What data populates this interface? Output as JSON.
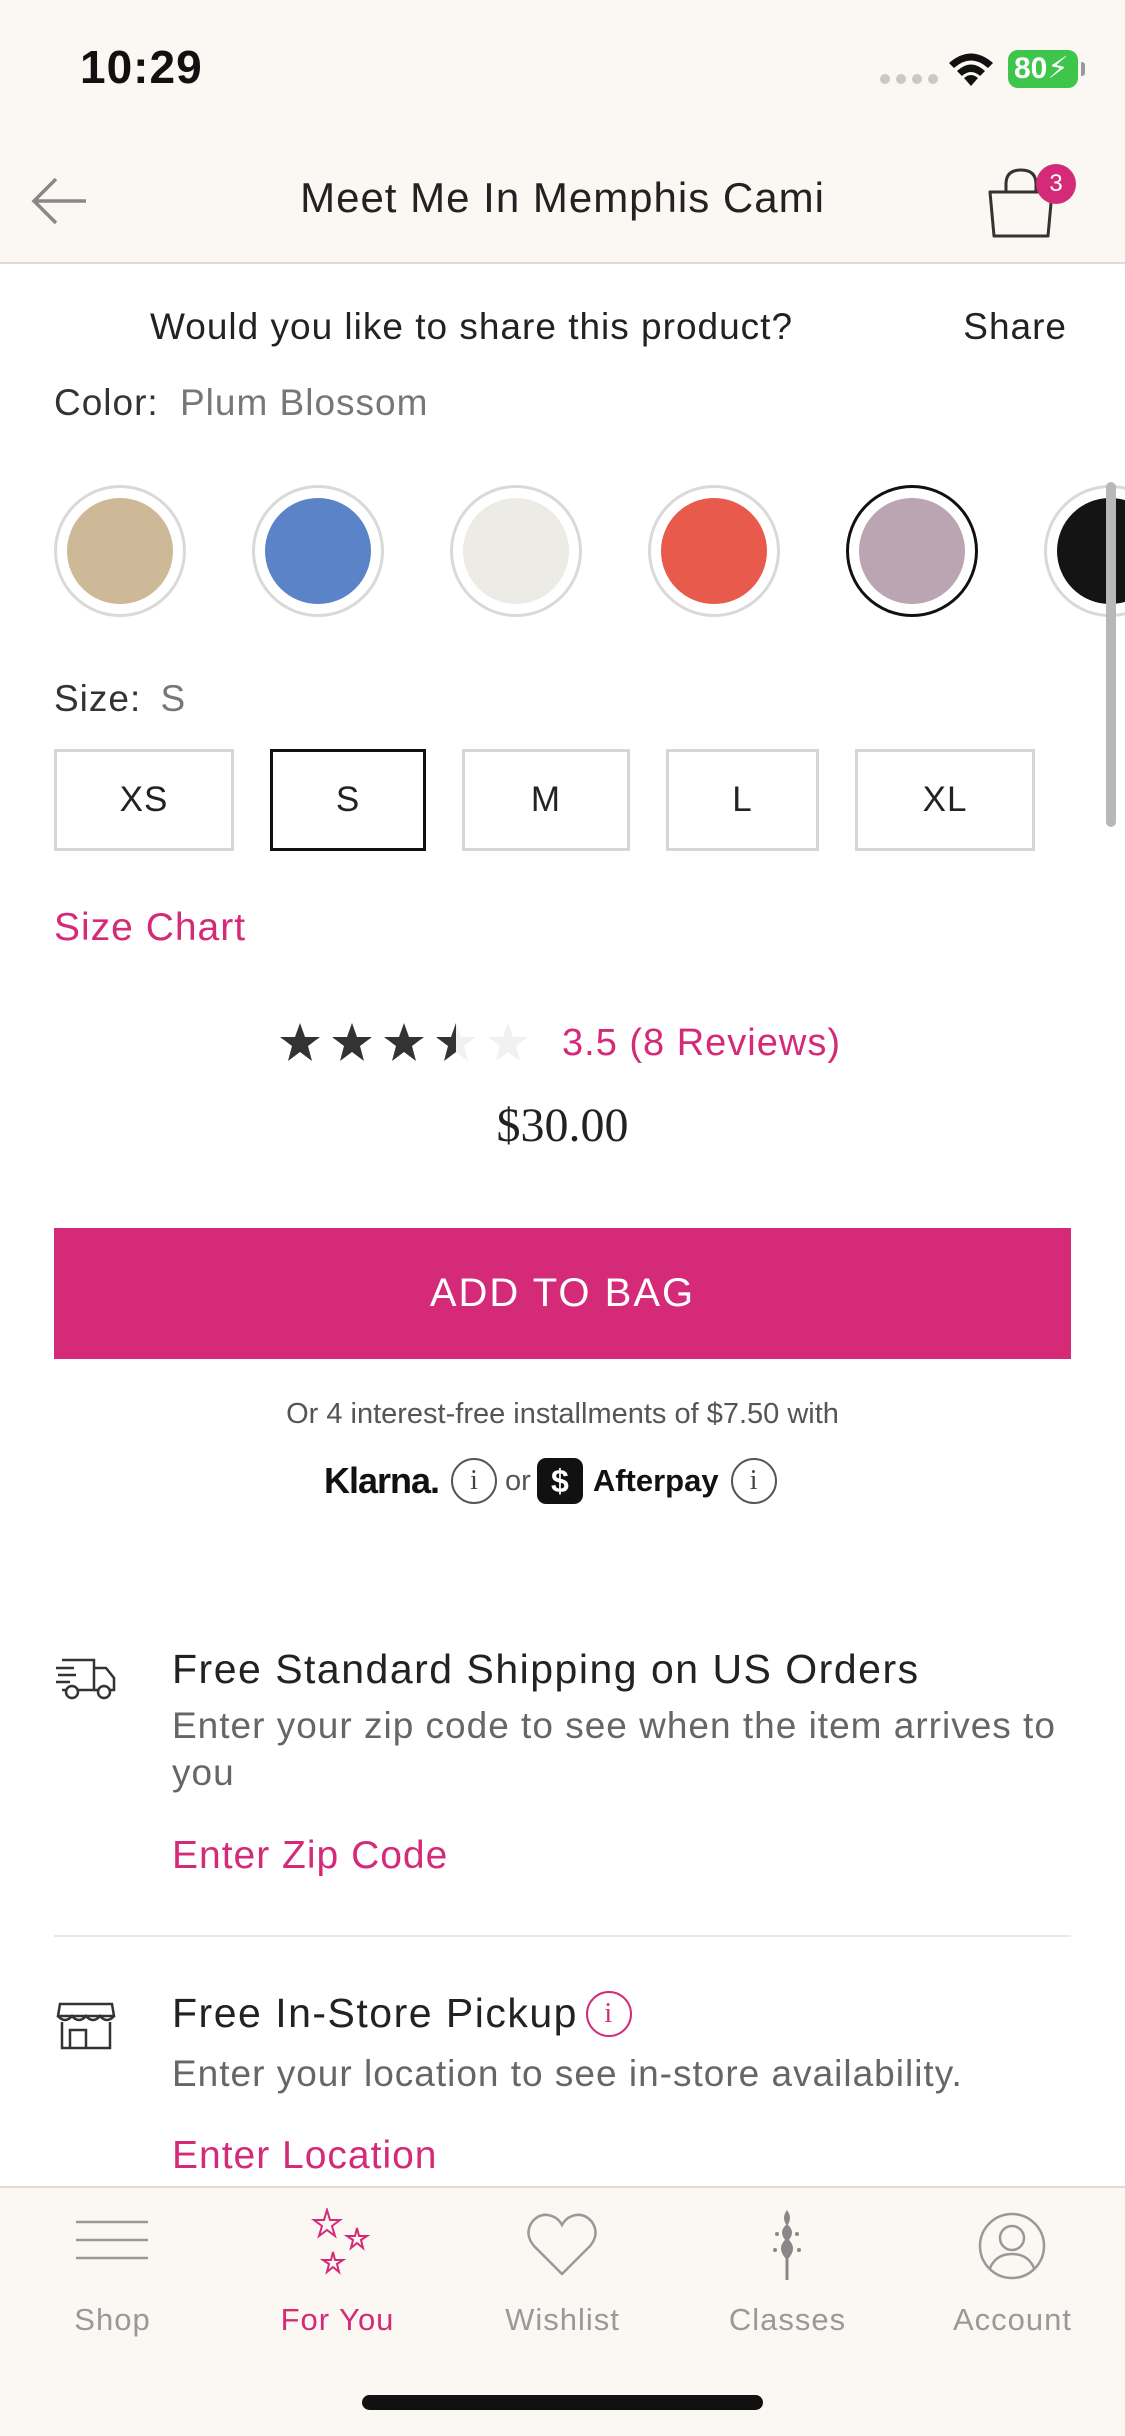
{
  "status_bar": {
    "time": "10:29",
    "battery": "80"
  },
  "header": {
    "title": "Meet Me In Memphis Cami",
    "bag_count": "3"
  },
  "share": {
    "prompt": "Would you like to share this product?",
    "action": "Share"
  },
  "color": {
    "label": "Color:",
    "selected": "Plum Blossom",
    "swatches": [
      {
        "name": "tan",
        "hex": "#cdb898"
      },
      {
        "name": "blue",
        "hex": "#5b84c8"
      },
      {
        "name": "white",
        "hex": "#ecebe5"
      },
      {
        "name": "coral",
        "hex": "#e85a4b"
      },
      {
        "name": "plum-blossom",
        "hex": "#bba5b3",
        "selected": true
      },
      {
        "name": "black",
        "hex": "#141414"
      }
    ]
  },
  "size": {
    "label": "Size:",
    "selected": "S",
    "options": [
      "XS",
      "S",
      "M",
      "L",
      "XL"
    ],
    "chart_link": "Size Chart"
  },
  "rating": {
    "value": 3.5,
    "max": 5,
    "text": "3.5 (8 Reviews)"
  },
  "price": "$30.00",
  "add_to_bag": "ADD TO BAG",
  "payment": {
    "installments": "Or 4 interest-free installments of $7.50 with",
    "klarna": "Klarna.",
    "info": "i",
    "or": "or",
    "afterpay": "Afterpay",
    "afterpay_mark": "$"
  },
  "shipping": {
    "title": "Free Standard Shipping on US Orders",
    "description": "Enter your zip code to see when the item arrives to you",
    "link": "Enter Zip Code"
  },
  "pickup": {
    "title": "Free In-Store Pickup",
    "info": "i",
    "description": "Enter your location to see in-store availability.",
    "link": "Enter Location"
  },
  "tabs": [
    {
      "label": "Shop",
      "icon": "menu-icon"
    },
    {
      "label": "For You",
      "icon": "sparkles-icon",
      "active": true
    },
    {
      "label": "Wishlist",
      "icon": "heart-icon"
    },
    {
      "label": "Classes",
      "icon": "flower-icon"
    },
    {
      "label": "Account",
      "icon": "account-icon"
    }
  ],
  "colors": {
    "accent": "#d42a78",
    "header_bg": "#fbf7f3"
  }
}
